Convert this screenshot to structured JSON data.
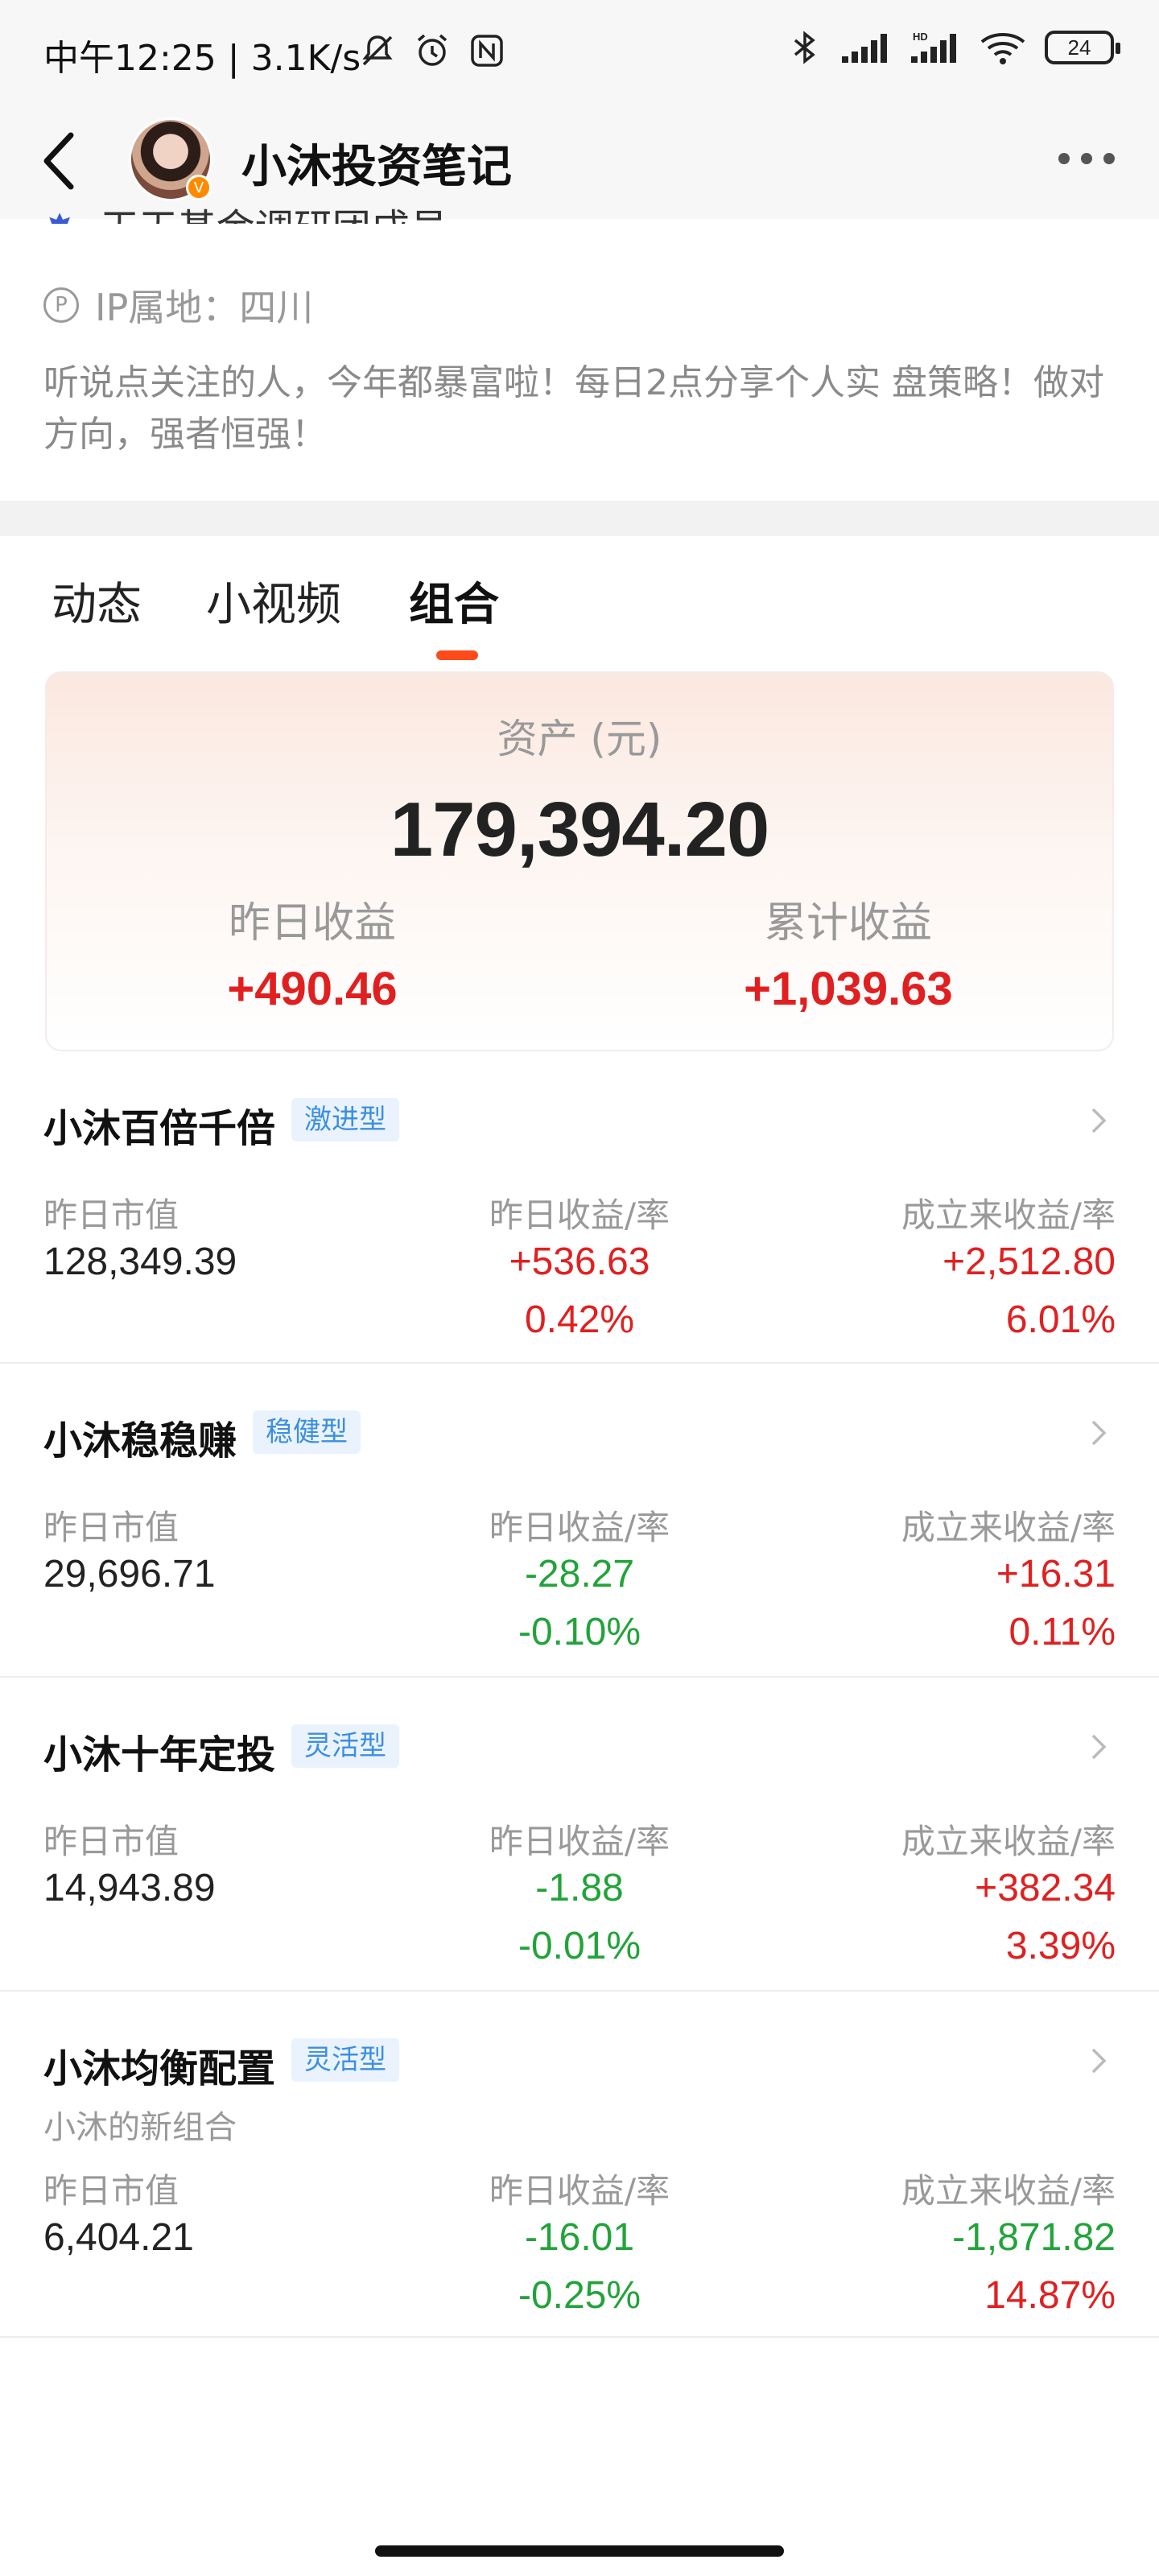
{
  "status_bar": {
    "time": "中午12:25 | 3.1K/s",
    "battery": "24"
  },
  "header": {
    "title": "小沐投资笔记",
    "avatar_badge": "V"
  },
  "profile": {
    "clipped_line": "天天基金调研团成员",
    "ip_location": "IP属地：四川",
    "bio": "听说点关注的人，今年都暴富啦！每日2点分享个人实 盘策略！做对方向，强者恒强！"
  },
  "tabs": [
    "动态",
    "小视频",
    "组合"
  ],
  "summary": {
    "asset_label": "资产 (元)",
    "asset_value": "179,394.20",
    "yesterday_label": "昨日收益",
    "yesterday_value": "+490.46",
    "cumulative_label": "累计收益",
    "cumulative_value": "+1,039.63"
  },
  "labels": {
    "market_value": "昨日市值",
    "yesterday": "昨日收益/率",
    "since_inception": "成立来收益/率"
  },
  "portfolios": [
    {
      "name": "小沐百倍千倍",
      "tag": "激进型",
      "market_value": "128,349.39",
      "y_amount": "+536.63",
      "y_rate": "0.42%",
      "s_amount": "+2,512.80",
      "s_rate": "6.01%"
    },
    {
      "name": "小沐稳稳赚",
      "tag": "稳健型",
      "market_value": "29,696.71",
      "y_amount": "-28.27",
      "y_rate": "-0.10%",
      "s_amount": "+16.31",
      "s_rate": "0.11%"
    },
    {
      "name": "小沐十年定投",
      "tag": "灵活型",
      "market_value": "14,943.89",
      "y_amount": "-1.88",
      "y_rate": "-0.01%",
      "s_amount": "+382.34",
      "s_rate": "3.39%"
    },
    {
      "name": "小沐均衡配置",
      "tag": "灵活型",
      "subtitle": "小沐的新组合",
      "market_value": "6,404.21",
      "y_amount": "-16.01",
      "y_rate": "-0.25%",
      "s_amount": "-1,871.82",
      "s_rate": "14.87%"
    }
  ]
}
